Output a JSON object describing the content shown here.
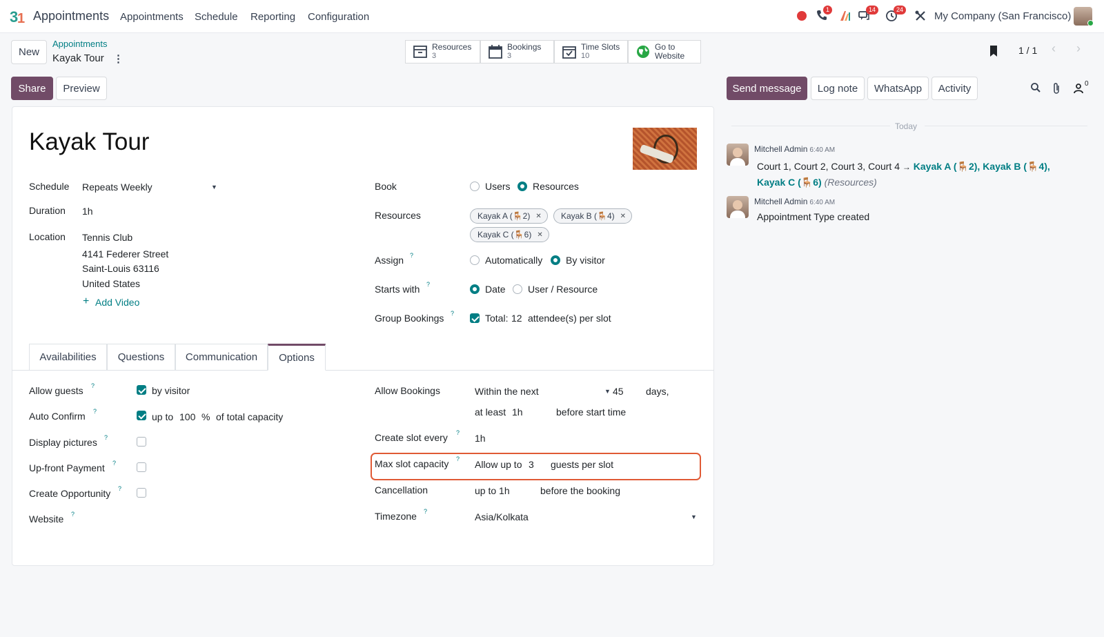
{
  "navbar": {
    "app_name": "Appointments",
    "menus": [
      "Appointments",
      "Schedule",
      "Reporting",
      "Configuration"
    ],
    "badges": {
      "calls": "1",
      "messages": "14",
      "activities": "24"
    },
    "company": "My Company (San Francisco)"
  },
  "control": {
    "new_label": "New",
    "breadcrumb_parent": "Appointments",
    "breadcrumb_current": "Kayak Tour",
    "pager": "1 / 1",
    "share_label": "Share",
    "preview_label": "Preview"
  },
  "smart_buttons": {
    "resources": {
      "title": "Resources",
      "count": "3"
    },
    "bookings": {
      "title": "Bookings",
      "count": "3"
    },
    "time_slots": {
      "title": "Time Slots",
      "count": "10"
    },
    "website": {
      "title_1": "Go to",
      "title_2": "Website"
    }
  },
  "form": {
    "title": "Kayak Tour",
    "schedule_label": "Schedule",
    "schedule_value": "Repeats Weekly",
    "duration_label": "Duration",
    "duration_value": "1h",
    "location_label": "Location",
    "location_lines": [
      "Tennis Club",
      "4141 Federer Street",
      "Saint-Louis 63116",
      "United States"
    ],
    "add_video": "Add Video",
    "book_label": "Book",
    "book_users": "Users",
    "book_resources": "Resources",
    "resources_label": "Resources",
    "resource_tags": [
      {
        "name": "Kayak A (",
        "cap": "2)"
      },
      {
        "name": "Kayak B (",
        "cap": "4)"
      },
      {
        "name": "Kayak C (",
        "cap": "6)"
      }
    ],
    "assign_label": "Assign",
    "assign_auto": "Automatically",
    "assign_visitor": "By visitor",
    "starts_label": "Starts with",
    "starts_date": "Date",
    "starts_user": "User / Resource",
    "group_label": "Group Bookings",
    "group_total": "Total:",
    "group_count": "12",
    "group_suffix": "attendee(s) per slot"
  },
  "tabs": [
    "Availabilities",
    "Questions",
    "Communication",
    "Options"
  ],
  "options": {
    "allow_guests_label": "Allow guests",
    "allow_guests_value": "by visitor",
    "auto_confirm_label": "Auto Confirm",
    "auto_confirm_upto": "up to",
    "auto_confirm_pct": "100",
    "auto_confirm_pct_sign": "%",
    "auto_confirm_suffix": "of total capacity",
    "display_pictures_label": "Display pictures",
    "upfront_label": "Up-front Payment",
    "opportunity_label": "Create Opportunity",
    "website_label": "Website",
    "allow_bookings_label": "Allow Bookings",
    "within_next": "Within the next",
    "within_days": "45",
    "days_label": "days,",
    "at_least": "at least",
    "at_least_val": "1h",
    "before_start": "before start time",
    "slot_every_label": "Create slot every",
    "slot_every_value": "1h",
    "max_cap_label": "Max slot capacity",
    "allow_up_to": "Allow up to",
    "max_cap_value": "3",
    "guests_per_slot": "guests per slot",
    "cancellation_label": "Cancellation",
    "cancel_value": "up to 1h",
    "before_booking": "before the booking",
    "timezone_label": "Timezone",
    "timezone_value": "Asia/Kolkata"
  },
  "chatter": {
    "send_message": "Send message",
    "log_note": "Log note",
    "whatsapp": "WhatsApp",
    "activity": "Activity",
    "followers_count": "0",
    "today": "Today",
    "msg1": {
      "author": "Mitchell Admin",
      "time": "6:40 AM",
      "old": "Court 1, Court 2, Court 3, Court 4",
      "arrow": "→",
      "new_1": "Kayak A (",
      "new_1b": "2), Kayak B (",
      "new_1c": "4),",
      "new_2": "Kayak C (",
      "new_2b": "6)",
      "field": "(Resources)"
    },
    "msg2": {
      "author": "Mitchell Admin",
      "time": "6:40 AM",
      "body": "Appointment Type created"
    }
  },
  "colors": {
    "brand": "#714b67",
    "accent": "#017e84",
    "highlight": "#e05a35"
  }
}
